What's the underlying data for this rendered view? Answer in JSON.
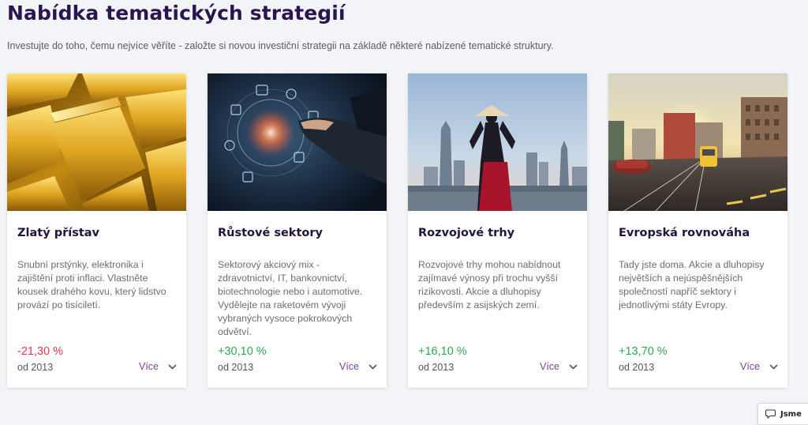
{
  "page": {
    "title": "Nabídka tematických strategií",
    "subtitle": "Investujte do toho, čemu nejvíce věříte - založte si novou investiční strategii na základě některé nabízené tematické struktury."
  },
  "cards": [
    {
      "title": "Zlatý přístav",
      "description": "Snubní prstýnky, elektronika i zajištění proti inflaci. Vlastněte kousek drahého kovu, který lidstvo provází po tisíciletí.",
      "performance": "-21,30 %",
      "since": "od 2013",
      "more_label": "Více",
      "image": "gold-bars"
    },
    {
      "title": "Růstové sektory",
      "description": "Sektorový akciový mix - zdravotnictví, IT, bankovnictví, biotechnologie nebo i automotive. Vydělejte na raketovém vývoji vybraných vysoce pokrokových odvětví.",
      "performance": "+30,10 %",
      "since": "od 2013",
      "more_label": "Více",
      "image": "tech-hand"
    },
    {
      "title": "Rozvojové trhy",
      "description": "Rozvojové trhy mohou nabídnout zajímavé výnosy při trochu vyšší rizikovosti. Akcie a dluhopisy především z asijských zemí.",
      "performance": "+16,10 %",
      "since": "od 2013",
      "more_label": "Více",
      "image": "asian-city-skyline"
    },
    {
      "title": "Evropská rovnováha",
      "description": "Tady jste doma. Akcie a dluhopisy největších a nejúspěšnějších společností napříč sektory i jednotlivými státy Evropy.",
      "performance": "+13,70 %",
      "since": "od 2013",
      "more_label": "Více",
      "image": "european-street-tram"
    }
  ],
  "chat": {
    "label": "Jsme",
    "icon": "chat-bubble-icon"
  },
  "colors": {
    "title": "#2a1550",
    "negative": "#e0384f",
    "positive": "#2fa84f",
    "link": "#7b3fa0"
  }
}
